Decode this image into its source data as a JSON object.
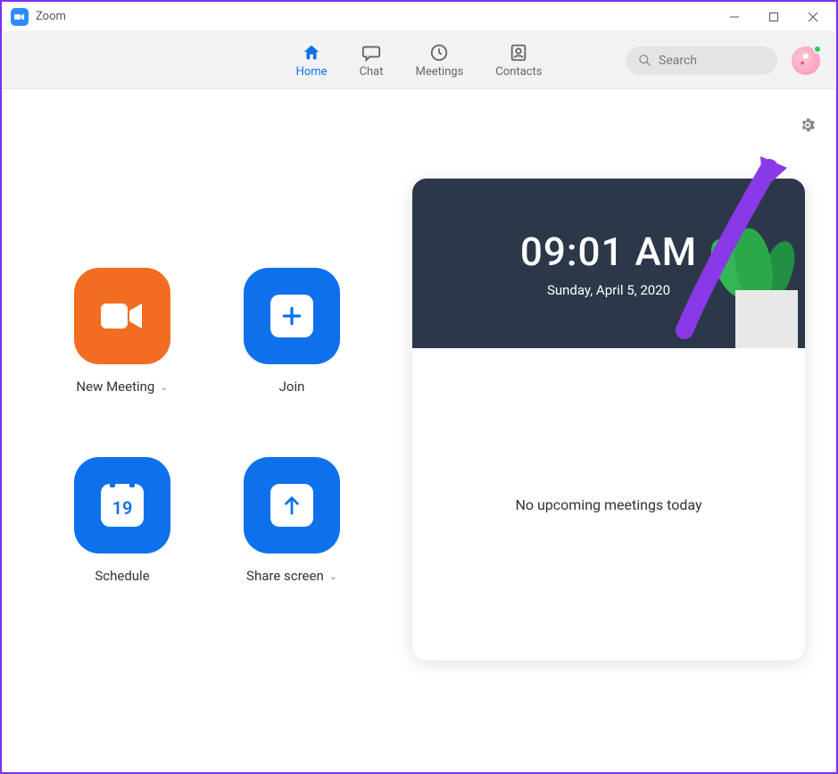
{
  "titlebar": {
    "app_name": "Zoom"
  },
  "nav": {
    "tabs": [
      {
        "label": "Home",
        "icon": "home-icon",
        "active": true
      },
      {
        "label": "Chat",
        "icon": "chat-icon",
        "active": false
      },
      {
        "label": "Meetings",
        "icon": "clock-icon",
        "active": false
      },
      {
        "label": "Contacts",
        "icon": "contacts-icon",
        "active": false
      }
    ],
    "search_placeholder": "Search"
  },
  "actions": {
    "new_meeting": "New Meeting",
    "join": "Join",
    "schedule": "Schedule",
    "schedule_day": "19",
    "share_screen": "Share screen"
  },
  "calendar": {
    "time": "09:01 AM",
    "date": "Sunday, April 5, 2020",
    "empty_message": "No upcoming meetings today"
  },
  "colors": {
    "accent_blue": "#0E71EB",
    "accent_orange": "#F26D21",
    "annotation": "#8A39E8"
  }
}
